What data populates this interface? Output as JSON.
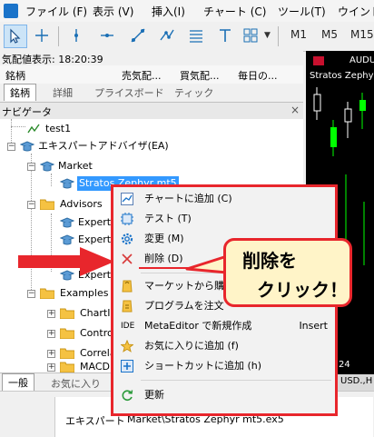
{
  "menubar": [
    "ファイル (F)",
    "表示 (V)",
    "挿入(I)",
    "チャート (C)",
    "ツール(T)",
    "ウインド"
  ],
  "toolbar": {
    "timeframes": [
      "M1",
      "M5",
      "M15"
    ]
  },
  "market_watch": {
    "header": "気配値表示: 18:20:39",
    "columns": [
      "銘柄",
      "売気配...",
      "買気配...",
      "毎日の..."
    ],
    "tabs": [
      "銘柄",
      "詳細",
      "プライスボード",
      "ティック"
    ]
  },
  "navigator": {
    "title": "ナビゲータ",
    "close": "×",
    "items": [
      "test1",
      "エキスパートアドバイザ(EA)",
      "Market",
      "Stratos Zephyr mt5",
      "Advisors",
      "Expert",
      "Expert",
      "Expert",
      "Examples",
      "ChartI",
      "Contro",
      "Correla",
      "MACD"
    ],
    "tabs": [
      "一般",
      "お気に入り"
    ]
  },
  "context_menu": {
    "items": [
      {
        "label": "チャートに追加 (C)",
        "icon": "chart-add-icon"
      },
      {
        "label": "テスト (T)",
        "icon": "test-icon"
      },
      {
        "label": "変更 (M)",
        "icon": "gear-icon"
      },
      {
        "label": "削除 (D)",
        "icon": "delete-x-icon"
      },
      {
        "label": "マーケットから購入",
        "icon": "cart-icon"
      },
      {
        "label": "プログラムを注文",
        "icon": "order-icon"
      },
      {
        "label": "MetaEditor で新規作成",
        "icon": "ide-icon",
        "shortcut": "Insert"
      },
      {
        "label": "お気に入りに追加 (f)",
        "icon": "star-icon"
      },
      {
        "label": "ショートカットに追加 (h)",
        "icon": "shortcut-icon"
      },
      {
        "label": "更新",
        "icon": "refresh-icon"
      }
    ]
  },
  "callout": {
    "line1": "削除を",
    "line2": "クリック！"
  },
  "chart": {
    "symbol": "AUDU",
    "subtitle": "Stratos Zephyr",
    "scale": [
      "24",
      "USD.,H"
    ]
  },
  "status": {
    "label": "エキスパート",
    "value": "Market\\Stratos Zephyr mt5.ex5"
  },
  "colors": {
    "accent_red": "#e8262c",
    "callout_bg": "#fff4c8",
    "selection": "#3399ff"
  }
}
